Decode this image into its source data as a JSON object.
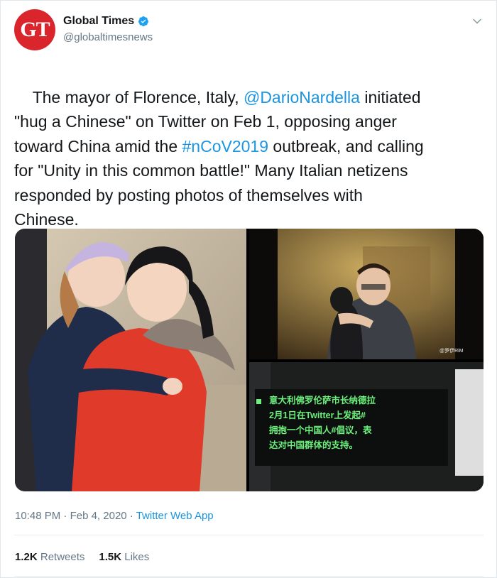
{
  "author": {
    "avatar_text": "GT",
    "name": "Global Times",
    "handle": "@globaltimesnews",
    "verified_icon": "verified-badge-icon",
    "brand_color": "#d9252b"
  },
  "menu_icon": "chevron-down-icon",
  "tweet": {
    "segments": [
      {
        "text": "The mayor of Florence, Italy, ",
        "link": false
      },
      {
        "text": "@DarioNardella",
        "link": true
      },
      {
        "text": " initiated\n\"hug a Chinese\" on Twitter on Feb 1, opposing anger\ntoward China amid the ",
        "link": false
      },
      {
        "text": "#nCoV2019",
        "link": true
      },
      {
        "text": " outbreak, and calling\nfor \"Unity in this common battle!\" Many Italian netizens\nresponded by posting photos of themselves with\nChinese.",
        "link": false
      }
    ],
    "link_color": "#1b95e0"
  },
  "media": {
    "caption_chinese": "意大利佛罗伦萨市长纳德拉\n2月1日在Twitter上发起#\n拥抱一个中国人#倡议，表\n达对中国群体的支持。",
    "watermark": "@罗伊RiM"
  },
  "meta": {
    "time": "10:48 PM",
    "sep": " · ",
    "date": "Feb 4, 2020",
    "sep2": " · ",
    "app": "Twitter Web App"
  },
  "stats": {
    "retweets_count": "1.2K",
    "retweets_label": "Retweets",
    "likes_count": "1.5K",
    "likes_label": "Likes"
  }
}
